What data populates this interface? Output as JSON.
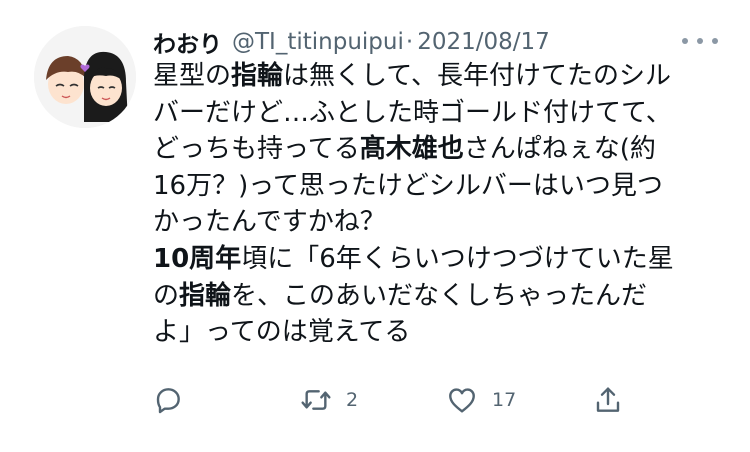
{
  "tweet": {
    "display_name": "わおり",
    "handle": "@TI_titinpuipui",
    "separator": "·",
    "date": "2021/08/17",
    "body": {
      "line1_a": "星型の",
      "line1_b": "指輪",
      "line1_c": "は無くして、長年付けてたのシル",
      "line2": "バーだけど…ふとした時ゴールド付けてて、",
      "line3_a": "どっちも持ってる",
      "line3_b": "髙木雄也",
      "line3_c": "さんぱねぇな(約",
      "line4": "16万？)って思ったけどシルバーはいつ見つ",
      "line5": "かったんですかね？",
      "line6_a": "10周年",
      "line6_b": "頃に「6年くらいつけつづけていた星",
      "line7_a": "の",
      "line7_b": "指輪",
      "line7_c": "を、このあいだなくしちゃったんだ",
      "line8": "よ」ってのは覚えてる"
    },
    "actions": {
      "reply_icon": "reply-icon",
      "retweet_icon": "retweet-icon",
      "retweet_count": "2",
      "like_icon": "heart-icon",
      "like_count": "17",
      "share_icon": "share-icon"
    },
    "colors": {
      "text": "#0f1419",
      "secondary": "#536471"
    }
  }
}
